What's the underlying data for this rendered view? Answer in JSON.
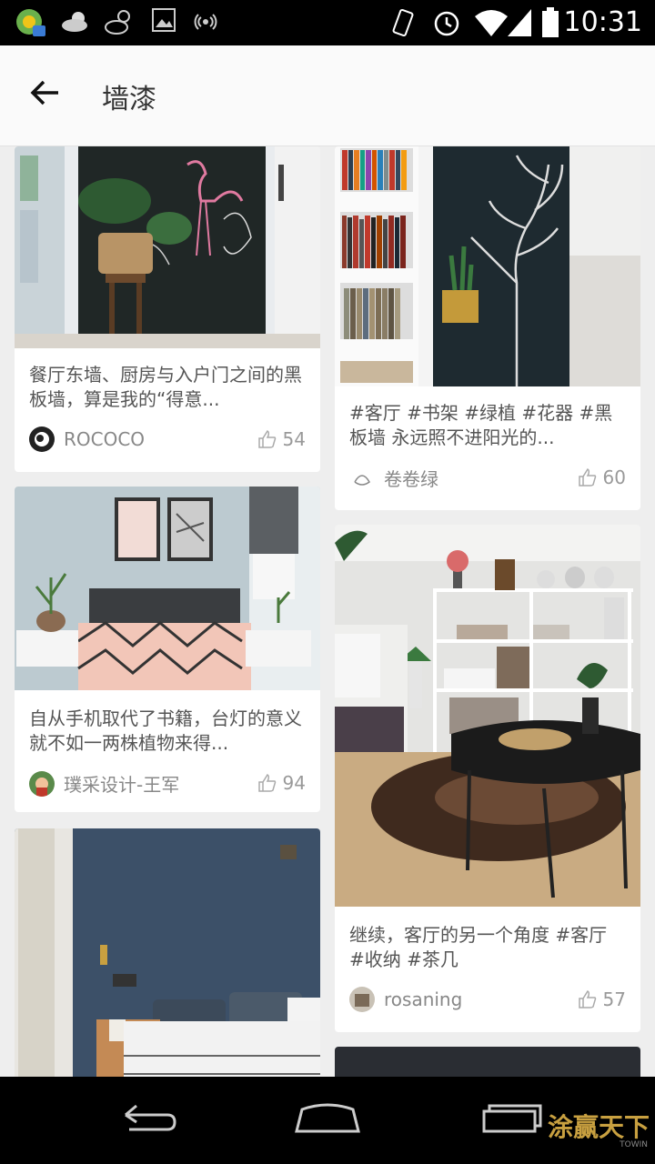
{
  "status_bar": {
    "time": "10:31"
  },
  "header": {
    "title": "墙漆"
  },
  "cards": [
    {
      "desc": "餐厅东墙、厨房与入户门之间的黑板墙，算是我的“得意...",
      "author": "ROCOCO",
      "likes": "54"
    },
    {
      "desc": "#客厅 #书架 #绿植 #花器 #黑板墙 永远照不进阳光的...",
      "author": "卷卷绿",
      "likes": "60"
    },
    {
      "desc": "自从手机取代了书籍，台灯的意义就不如一两株植物来得...",
      "author": "璞采设计-王军",
      "likes": "94"
    },
    {
      "desc": "继续，客厅的另一个角度 #客厅 #收纳 #茶几",
      "author": "rosaning",
      "likes": "57"
    }
  ],
  "watermark": {
    "text": "涂赢天下",
    "sub": "TOWIN"
  },
  "colors": {
    "accent": "#000000",
    "text": "#555555",
    "muted": "#888888"
  }
}
